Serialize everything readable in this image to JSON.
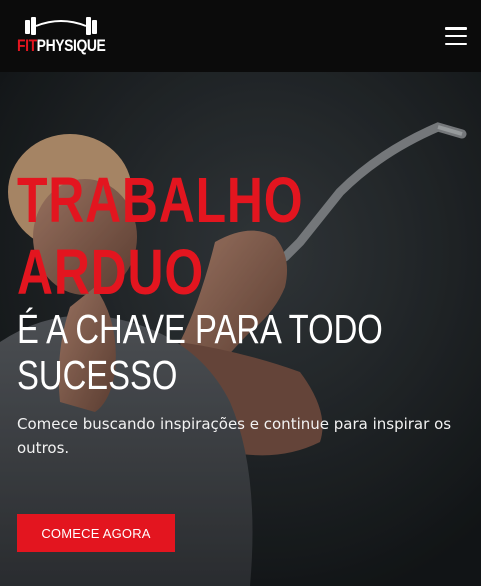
{
  "header": {
    "logo": {
      "part1": "FIT",
      "part2": "PHYSIQUE"
    },
    "menu_icon": "hamburger-menu-icon"
  },
  "hero": {
    "headline_line1": "TRABALHO",
    "headline_line2": "ARDUO",
    "subheadline_line1": "É A CHAVE PARA TODO",
    "subheadline_line2": "SUCESSO",
    "tagline": "Comece buscando inspirações e continue para inspirar os outros.",
    "cta_label": "COMECE AGORA"
  },
  "colors": {
    "accent": "#e3151f",
    "header_bg": "#0b0b0b",
    "text": "#ffffff"
  }
}
